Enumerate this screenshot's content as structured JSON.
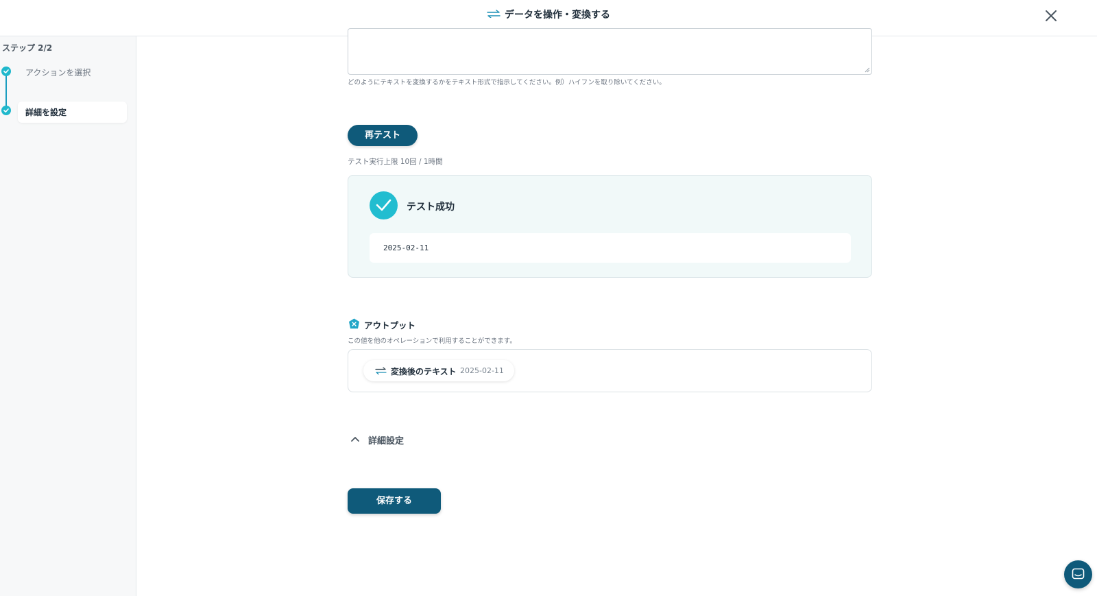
{
  "header": {
    "title": "データを操作・変換する",
    "icon": "swap-arrows-icon",
    "close_icon": "close-icon"
  },
  "sidebar": {
    "step_count": "ステップ 2/2",
    "steps": [
      {
        "label": "アクションを選択",
        "done": true,
        "active": false
      },
      {
        "label": "詳細を設定",
        "done": true,
        "active": true
      }
    ]
  },
  "main": {
    "instruction_value": "",
    "hint": "どのようにテキストを変換するかをテキスト形式で指示してください。例）ハイフンを取り除いてください。",
    "retest_label": "再テスト",
    "test_limit": "テスト実行上限 10回 / 1時間",
    "test_result": {
      "status": "テスト成功",
      "value": "2025-02-11"
    },
    "output": {
      "title": "アウトプット",
      "description": "この値を他のオペレーションで利用することができます。",
      "items": [
        {
          "label": "変換後のテキスト",
          "value": "2025-02-11"
        }
      ]
    },
    "advanced_label": "詳細設定",
    "save_label": "保存する"
  },
  "colors": {
    "primary": "#0f5a7a",
    "accent": "#22bdd0",
    "success_bg": "#f1f9f9"
  },
  "chat_icon": "chat-icon"
}
